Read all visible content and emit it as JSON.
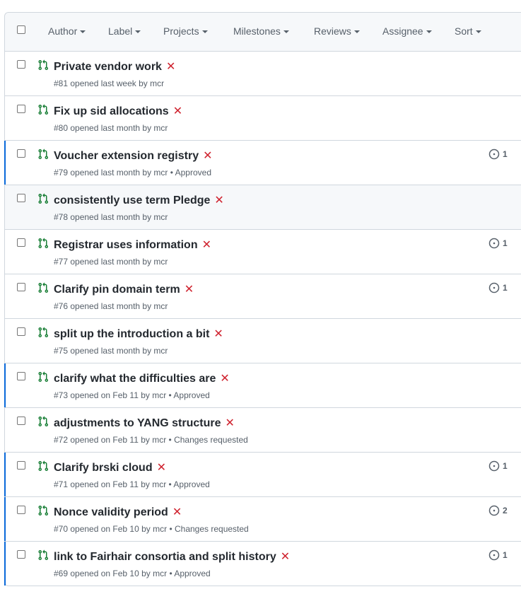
{
  "filters": [
    "Author",
    "Label",
    "Projects",
    "Milestones",
    "Reviews",
    "Assignee",
    "Sort"
  ],
  "rows": [
    {
      "title": "Private vendor work",
      "meta": "#81 opened last week by mcr",
      "comments": "",
      "unread": false,
      "hover": false
    },
    {
      "title": "Fix up sid allocations",
      "meta": "#80 opened last month by mcr",
      "comments": "",
      "unread": false,
      "hover": false
    },
    {
      "title": "Voucher extension registry",
      "meta": "#79 opened last month by mcr • Approved",
      "comments": "1",
      "unread": true,
      "hover": false
    },
    {
      "title": "consistently use term Pledge",
      "meta": "#78 opened last month by mcr",
      "comments": "",
      "unread": false,
      "hover": true
    },
    {
      "title": "Registrar uses information",
      "meta": "#77 opened last month by mcr",
      "comments": "1",
      "unread": false,
      "hover": false
    },
    {
      "title": "Clarify pin domain term",
      "meta": "#76 opened last month by mcr",
      "comments": "1",
      "unread": false,
      "hover": false
    },
    {
      "title": "split up the introduction a bit",
      "meta": "#75 opened last month by mcr",
      "comments": "",
      "unread": false,
      "hover": false
    },
    {
      "title": "clarify what the difficulties are",
      "meta": "#73 opened on Feb 11 by mcr • Approved",
      "comments": "",
      "unread": true,
      "hover": false
    },
    {
      "title": "adjustments to YANG structure",
      "meta": "#72 opened on Feb 11 by mcr • Changes requested",
      "comments": "",
      "unread": false,
      "hover": false
    },
    {
      "title": "Clarify brski cloud",
      "meta": "#71 opened on Feb 11 by mcr • Approved",
      "comments": "1",
      "unread": true,
      "hover": false
    },
    {
      "title": "Nonce validity period",
      "meta": "#70 opened on Feb 10 by mcr • Changes requested",
      "comments": "2",
      "unread": true,
      "hover": false
    },
    {
      "title": "link to Fairhair consortia and split history",
      "meta": "#69 opened on Feb 10 by mcr • Approved",
      "comments": "1",
      "unread": true,
      "hover": false
    }
  ],
  "status_mark": "✕",
  "icons": {
    "row": "git-pull-request-icon",
    "status": "x-icon",
    "comment": "comment-circle-icon"
  },
  "colors": {
    "pr_open": "#1a7f37",
    "failure": "#cf222e",
    "unread_bar": "#0969da"
  }
}
